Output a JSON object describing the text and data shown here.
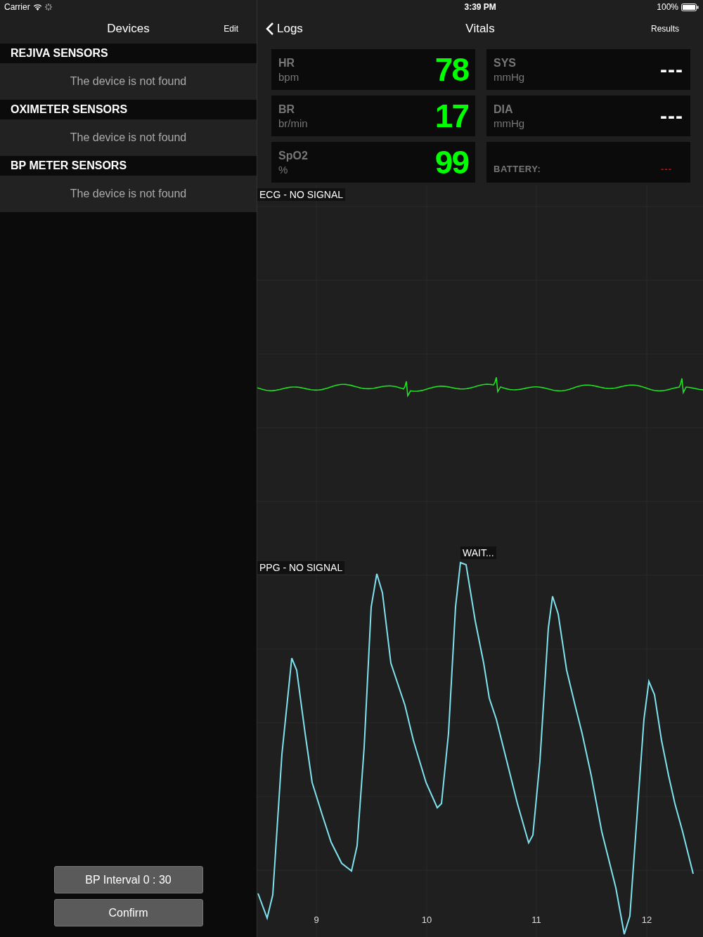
{
  "status_bar": {
    "carrier": "Carrier",
    "time": "3:39 PM",
    "battery": "100%"
  },
  "devices": {
    "title": "Devices",
    "edit": "Edit",
    "sections": [
      {
        "header": "REJIVA SENSORS",
        "message": "The device is not found"
      },
      {
        "header": "OXIMETER SENSORS",
        "message": "The device is not found"
      },
      {
        "header": "BP METER SENSORS",
        "message": "The device is not found"
      }
    ],
    "buttons": [
      "BP Interval 0 : 30",
      "Confirm"
    ]
  },
  "vitals": {
    "back": "Logs",
    "title": "Vitals",
    "action": "Results",
    "tiles": [
      {
        "kind": "reading",
        "label": "HR",
        "unit": "bpm",
        "value": "78"
      },
      {
        "kind": "blank",
        "label": "SYS",
        "unit": "mmHg",
        "value": "---"
      },
      {
        "kind": "reading",
        "label": "BR",
        "unit": "br/min",
        "value": "17"
      },
      {
        "kind": "blank",
        "label": "DIA",
        "unit": "mmHg",
        "value": "---"
      },
      {
        "kind": "reading",
        "label": "SpO2",
        "unit": "%",
        "value": "99"
      },
      {
        "kind": "battery",
        "label": "BATTERY:",
        "value": "---"
      }
    ],
    "ecg_label": "ECG - NO SIGNAL",
    "ppg_label": "PPG - NO SIGNAL",
    "wait": "WAIT...",
    "x_labels": [
      "9",
      "10",
      "11",
      "12"
    ]
  }
}
